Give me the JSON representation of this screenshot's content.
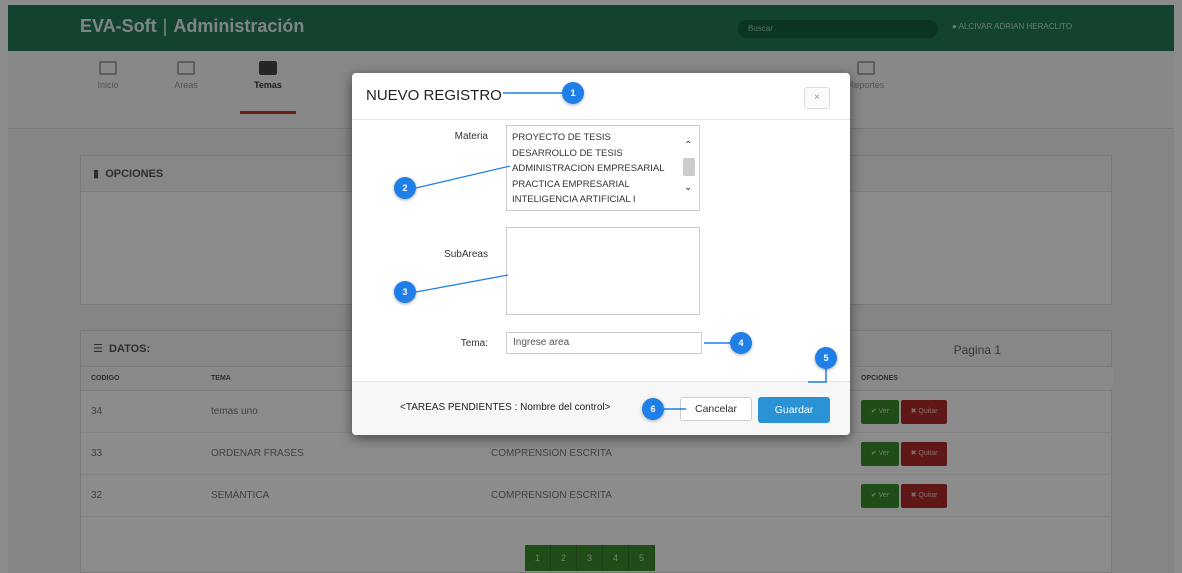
{
  "app": {
    "brand": "EVA-Soft",
    "brand_section": "Administración",
    "search_placeholder": "Buscar",
    "user": "ALCIVAR ADRIAN HERACLITO"
  },
  "menu": [
    {
      "label": "Inicio",
      "icon": "home-icon"
    },
    {
      "label": "Areas",
      "icon": "edit-icon"
    },
    {
      "label": "Temas",
      "icon": "list-icon",
      "active": true
    },
    {
      "label": "Reportes",
      "icon": "report-icon"
    }
  ],
  "options_panel": {
    "title": "OPCIONES"
  },
  "data_panel": {
    "title": "DATOS:",
    "page_label": "Pagina 1",
    "columns": [
      "CODIGO",
      "TEMA",
      "OPCIONES"
    ],
    "rows": [
      {
        "code": "34",
        "tema": "temas uno",
        "area": ""
      },
      {
        "code": "33",
        "tema": "ORDENAR FRASES",
        "area": "COMPRENSION ESCRITA"
      },
      {
        "code": "32",
        "tema": "SEMÁNTICA",
        "area": "COMPRENSION ESCRITA"
      }
    ],
    "btn_ver": "✔ Ver",
    "btn_quitar": "✖ Quitar",
    "pages": [
      "1",
      "2",
      "3",
      "4",
      "5"
    ]
  },
  "modal": {
    "title": "NUEVO REGISTRO",
    "close": "×",
    "materia_label": "Materia",
    "materia_options": [
      "PROYECTO DE TESIS",
      "DESARROLLO DE TESIS",
      "ADMINISTRACION EMPRESARIAL",
      "PRACTICA EMPRESARIAL",
      "INTELIGENCIA ARTIFICIAL I"
    ],
    "subareas_label": "SubAreas",
    "tema_label": "Tema:",
    "tema_placeholder": "Ingrese area",
    "pending_note": "<TAREAS PENDIENTES : Nombre del control>",
    "cancel_label": "Cancelar",
    "save_label": "Guardar"
  },
  "callouts": [
    "1",
    "2",
    "3",
    "4",
    "5",
    "6"
  ],
  "colors": {
    "navbar": "#1f7a55",
    "callout": "#1f7ee8",
    "save_button": "#2a93d5",
    "ver_button": "#3a8a2a",
    "quitar_button": "#b02a2a"
  }
}
